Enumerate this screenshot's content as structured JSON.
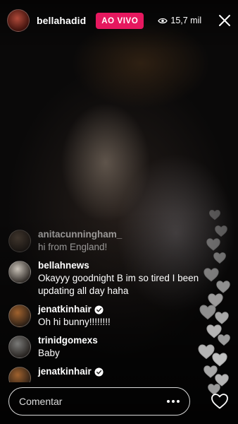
{
  "header": {
    "username": "bellahadid",
    "live_label": "AO VIVO",
    "viewer_count": "15,7 mil",
    "viewer_icon": "eye-icon",
    "close_icon": "close-icon"
  },
  "comments": [
    {
      "user": "anitacunningham_",
      "text": "hi from England!",
      "verified": false,
      "faded": true,
      "avatar_color": "#6b5a4a"
    },
    {
      "user": "bellahnews",
      "text": "Okayyy goodnight B im so tired I been updating all day haha",
      "verified": false,
      "faded": false,
      "avatar_color": "#c9c2b8"
    },
    {
      "user": "jenatkinhair",
      "text": "Oh hi bunny!!!!!!!!",
      "verified": true,
      "faded": false,
      "avatar_color": "#a0622e"
    },
    {
      "user": "trinidgomexs",
      "text": "Baby",
      "verified": false,
      "faded": false,
      "avatar_color": "#7a7a78"
    },
    {
      "user": "jenatkinhair",
      "text": "",
      "verified": true,
      "faded": false,
      "avatar_color": "#a0622e"
    }
  ],
  "footer": {
    "comment_placeholder": "Comentar",
    "more_icon": "more-options-icon",
    "like_icon": "heart-icon"
  },
  "colors": {
    "live_badge": "#e6185f",
    "text": "#ffffff"
  }
}
